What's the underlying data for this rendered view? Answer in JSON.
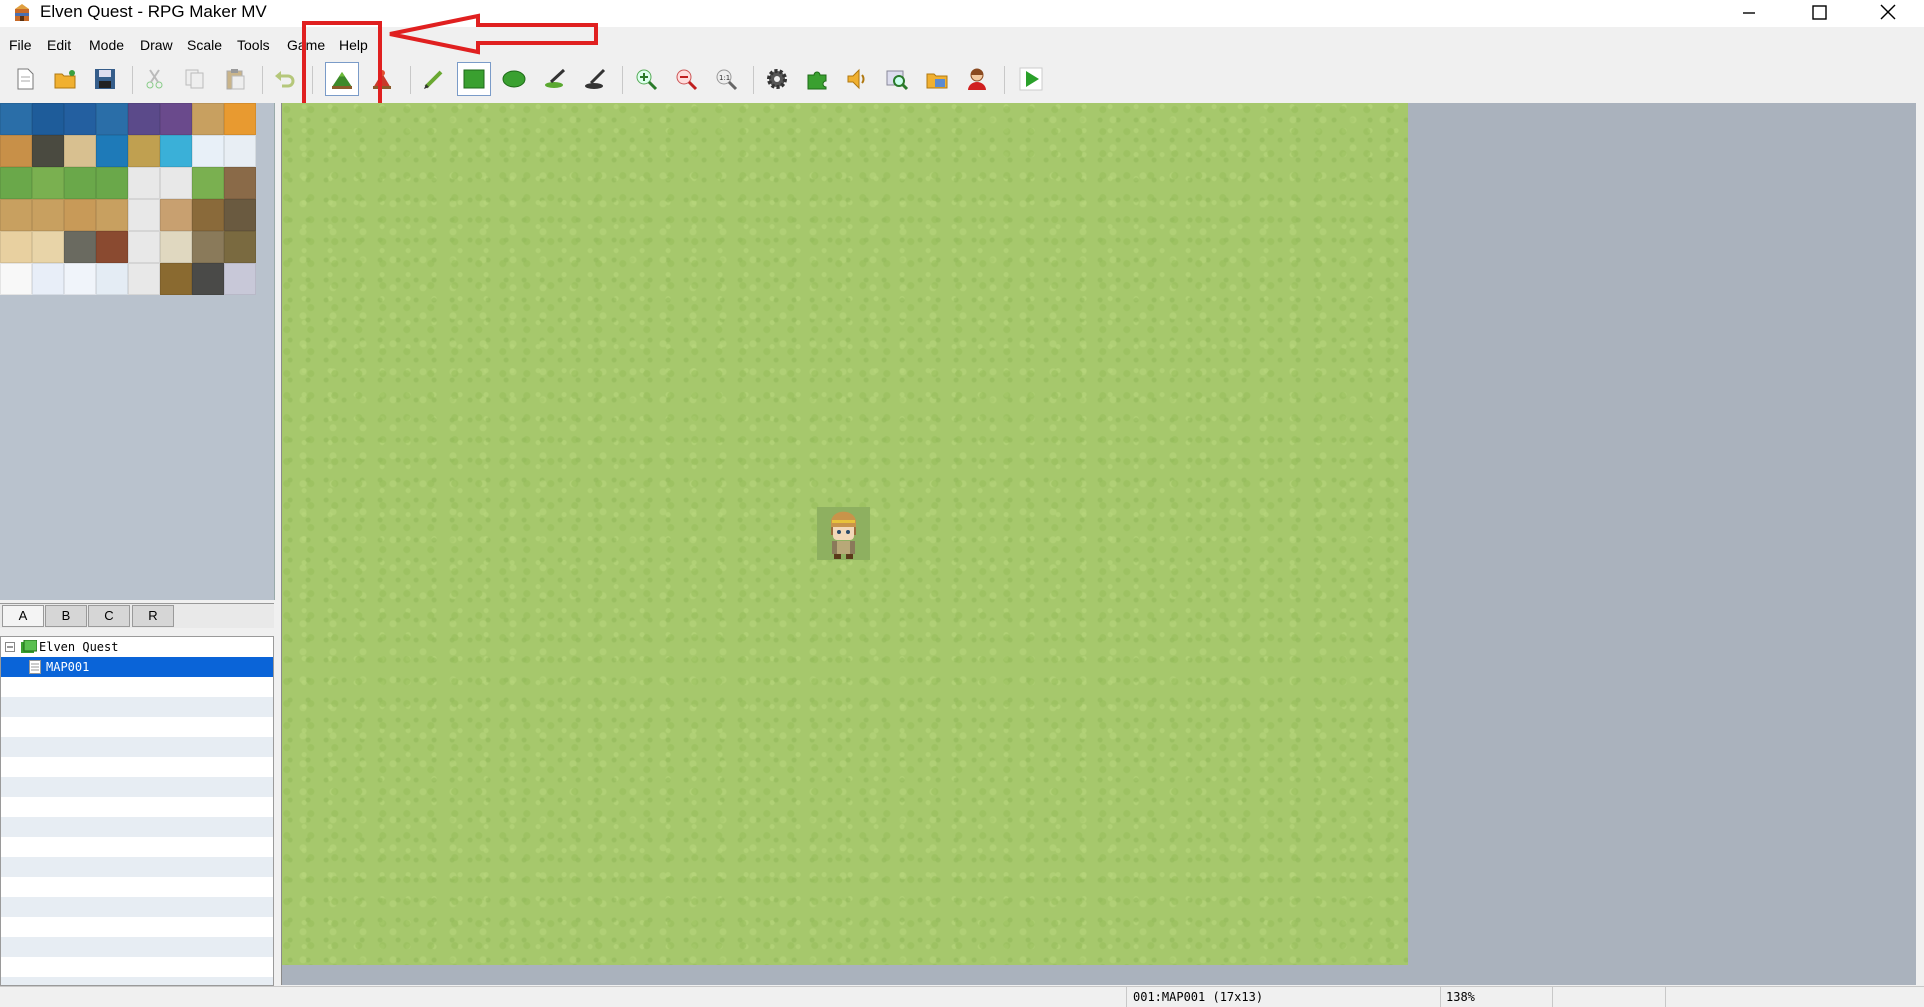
{
  "window": {
    "title": "Elven Quest - RPG Maker MV",
    "controls": [
      "minimize",
      "maximize",
      "close"
    ]
  },
  "menu": [
    "File",
    "Edit",
    "Mode",
    "Draw",
    "Scale",
    "Tools",
    "Game",
    "Help"
  ],
  "toolbar": {
    "groups": [
      [
        "new-project",
        "open-project",
        "save-project"
      ],
      [
        "cut",
        "copy",
        "paste"
      ],
      [
        "undo"
      ],
      [
        "map-mode",
        "event-mode"
      ],
      [
        "pencil",
        "rectangle",
        "ellipse",
        "flood-fill",
        "shadow-pen"
      ],
      [
        "zoom-in",
        "zoom-out",
        "actual-size"
      ],
      [
        "database",
        "plugin-manager",
        "sound-test",
        "event-searcher",
        "resource-manager",
        "character-generator"
      ],
      [
        "playtest"
      ]
    ],
    "active": "map-mode"
  },
  "annotation": {
    "highlight_color": "#e02020"
  },
  "tileset": {
    "tabs": [
      "A",
      "B",
      "C",
      "R"
    ],
    "active_tab": "A"
  },
  "map_tree": {
    "project": "Elven Quest",
    "maps": [
      {
        "name": "MAP001",
        "selected": true
      }
    ]
  },
  "map": {
    "grass_color": "#a6c86c",
    "background": "#aab2bd"
  },
  "status": {
    "map_info": "001:MAP001 (17x13)",
    "zoom": "138%"
  }
}
